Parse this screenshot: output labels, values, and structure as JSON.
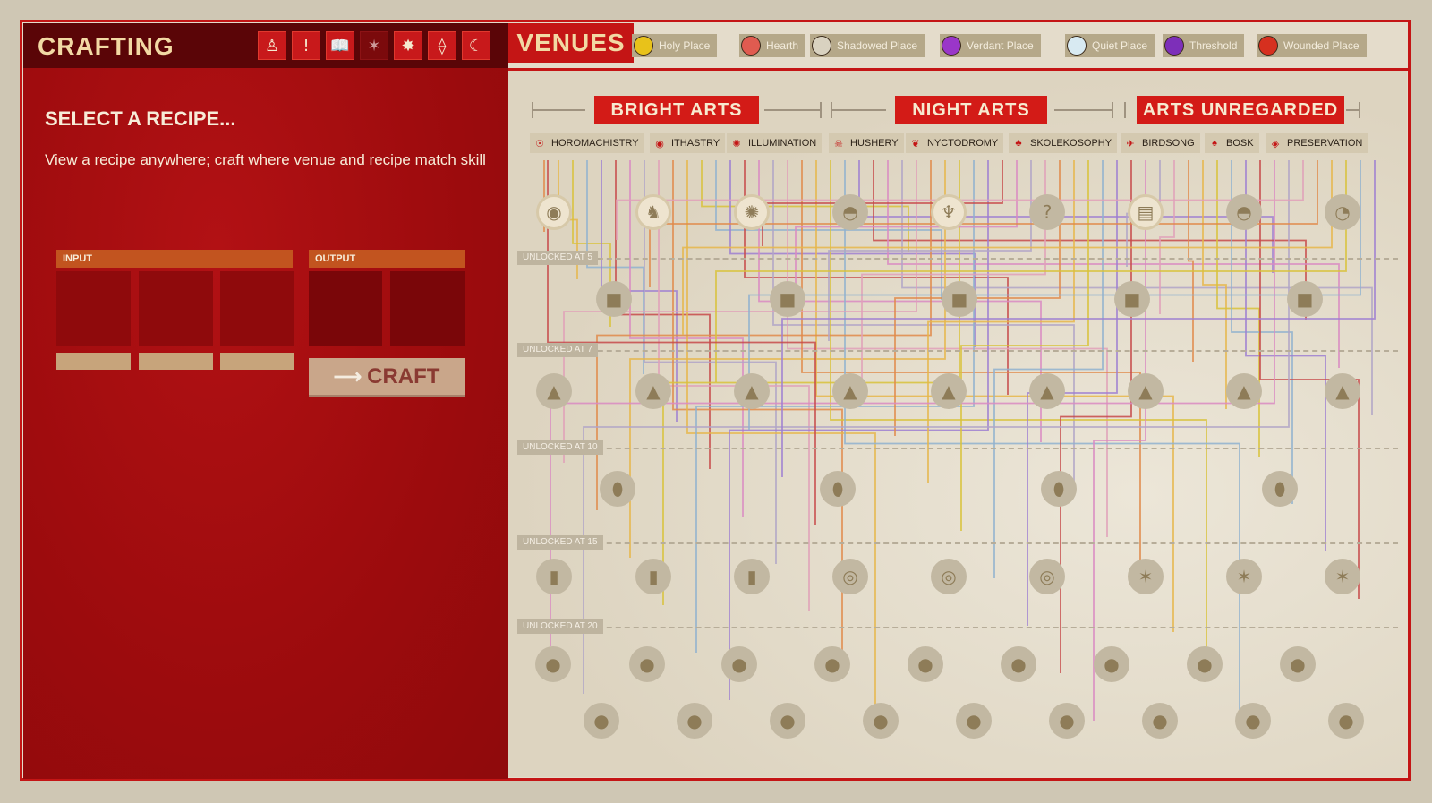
{
  "crafting": {
    "title": "CRAFTING",
    "toolbar": [
      {
        "name": "tool-1",
        "glyph": "♙",
        "active": true
      },
      {
        "name": "tool-2",
        "glyph": "ǃ",
        "active": true
      },
      {
        "name": "tool-3",
        "glyph": "📖",
        "active": true
      },
      {
        "name": "tool-4",
        "glyph": "✶",
        "active": false
      },
      {
        "name": "tool-5",
        "glyph": "✸",
        "active": true
      },
      {
        "name": "tool-6",
        "glyph": "⟠",
        "active": true
      },
      {
        "name": "tool-7",
        "glyph": "☾",
        "active": true
      }
    ],
    "select_title": "SELECT A RECIPE...",
    "description": "View a recipe anywhere; craft where venue and recipe match skill",
    "input_label": "INPUT",
    "output_label": "OUTPUT",
    "craft_label": "CRAFT"
  },
  "venues": {
    "title": "VENUES",
    "items": [
      {
        "label": "Holy Place",
        "color": "#e8c21a"
      },
      {
        "label": "Hearth",
        "color": "#e05b50"
      },
      {
        "label": "Shadowed Place",
        "color": "#d9d2c0"
      },
      {
        "label": "Verdant Place",
        "color": "#9a36c9"
      },
      {
        "label": "Quiet Place",
        "color": "#d8eaf2"
      },
      {
        "label": "Threshold",
        "color": "#7d2fb9"
      },
      {
        "label": "Wounded Place",
        "color": "#d6301f"
      }
    ]
  },
  "arts": {
    "headings": [
      "BRIGHT ARTS",
      "NIGHT ARTS",
      "ARTS UNREGARDED"
    ],
    "skills": [
      {
        "label": "HOROMACHISTRY",
        "icon": "☉"
      },
      {
        "label": "ITHASTRY",
        "icon": "◉"
      },
      {
        "label": "ILLUMINATION",
        "icon": "✺"
      },
      {
        "label": "HUSHERY",
        "icon": "☠"
      },
      {
        "label": "NYCTODROMY",
        "icon": "❦"
      },
      {
        "label": "SKOLEKOSOPHY",
        "icon": "♣"
      },
      {
        "label": "BIRDSONG",
        "icon": "✈"
      },
      {
        "label": "BOSK",
        "icon": "♠"
      },
      {
        "label": "PRESERVATION",
        "icon": "◈"
      }
    ],
    "unlocks": [
      "UNLOCKED AT 5",
      "UNLOCKED AT 7",
      "UNLOCKED AT 10",
      "UNLOCKED AT 15",
      "UNLOCKED AT 20"
    ],
    "top_nodes": [
      "◉",
      "♞",
      "✺",
      "◓",
      "♆",
      "?",
      "▤",
      "◓",
      "◔"
    ],
    "node_glyph_question": "?"
  }
}
